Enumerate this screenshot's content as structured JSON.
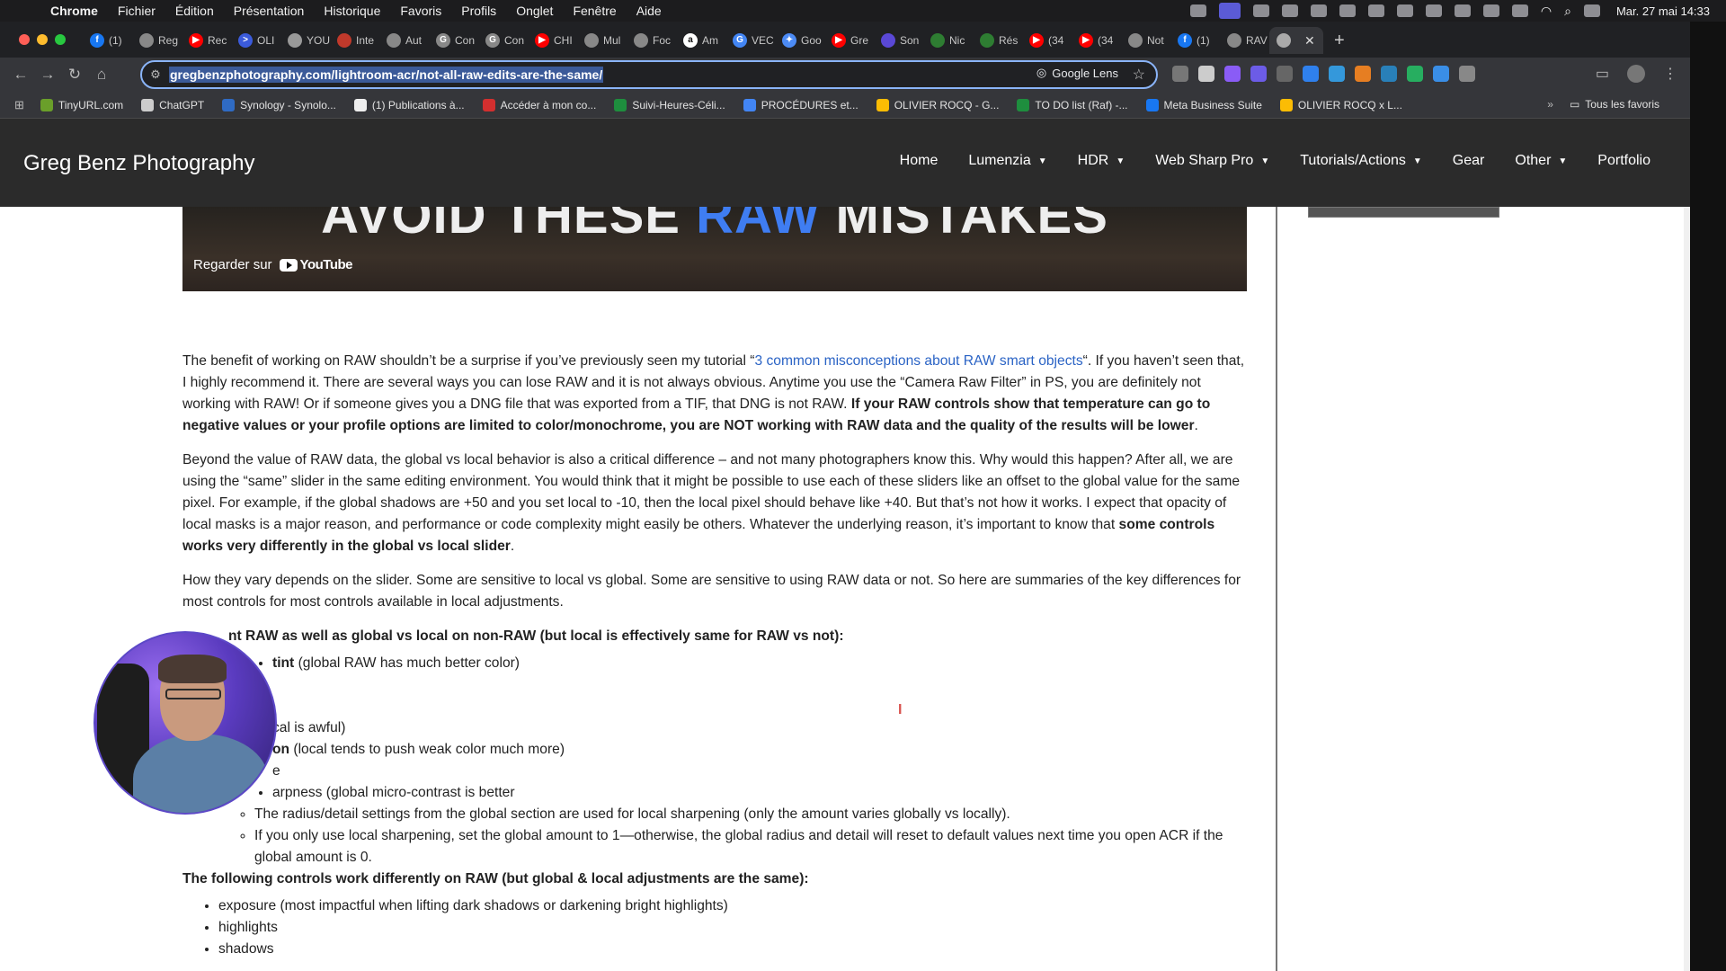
{
  "menubar": {
    "items": [
      "Chrome",
      "Fichier",
      "Édition",
      "Présentation",
      "Historique",
      "Favoris",
      "Profils",
      "Onglet",
      "Fenêtre",
      "Aide"
    ],
    "clock": "Mar. 27 mai  14:33"
  },
  "tabs": [
    {
      "label": "(1)",
      "color": "#1877f2",
      "glyph": "f"
    },
    {
      "label": "Reg",
      "color": "#888888",
      "glyph": ""
    },
    {
      "label": "Rec",
      "color": "#ff0000",
      "glyph": "▶"
    },
    {
      "label": "OLI",
      "color": "#3b5bdb",
      "glyph": ">"
    },
    {
      "label": "YOU",
      "color": "#999999",
      "glyph": ""
    },
    {
      "label": "Inte",
      "color": "#c0392b",
      "glyph": ""
    },
    {
      "label": "Aut",
      "color": "#888888",
      "glyph": ""
    },
    {
      "label": "Con",
      "color": "#888888",
      "glyph": "G"
    },
    {
      "label": "Con",
      "color": "#888888",
      "glyph": "G"
    },
    {
      "label": "CHI",
      "color": "#ff0000",
      "glyph": "▶"
    },
    {
      "label": "Mul",
      "color": "#888888",
      "glyph": ""
    },
    {
      "label": "Foc",
      "color": "#888888",
      "glyph": ""
    },
    {
      "label": "Am",
      "color": "#ffffff",
      "glyph": "a"
    },
    {
      "label": "VEC",
      "color": "#4285f4",
      "glyph": "G"
    },
    {
      "label": "Goo",
      "color": "#4c8bf5",
      "glyph": "✦"
    },
    {
      "label": "Gre",
      "color": "#ff0000",
      "glyph": "▶"
    },
    {
      "label": "Son",
      "color": "#5a48d6",
      "glyph": ""
    },
    {
      "label": "Nic",
      "color": "#2e7d32",
      "glyph": ""
    },
    {
      "label": "Rés",
      "color": "#2e7d32",
      "glyph": ""
    },
    {
      "label": "(34",
      "color": "#ff0000",
      "glyph": "▶"
    },
    {
      "label": "(34",
      "color": "#ff0000",
      "glyph": "▶"
    },
    {
      "label": "Not",
      "color": "#888888",
      "glyph": ""
    },
    {
      "label": "(1)",
      "color": "#1877f2",
      "glyph": "f"
    },
    {
      "label": "RAV",
      "color": "#888888",
      "glyph": ""
    },
    {
      "label": "",
      "color": "#aaaaaa",
      "glyph": ""
    }
  ],
  "omnibox": {
    "url": "gregbenzphotography.com/lightroom-acr/not-all-raw-edits-are-the-same/",
    "lens_label": "Google Lens"
  },
  "bookmarks": [
    {
      "label": "TinyURL.com",
      "color": "#6a9f2a"
    },
    {
      "label": "ChatGPT",
      "color": "#cccccc"
    },
    {
      "label": "Synology - Synolo...",
      "color": "#2f6bc4"
    },
    {
      "label": "(1) Publications à...",
      "color": "#eeeeee"
    },
    {
      "label": "Accéder à mon co...",
      "color": "#d32f2f"
    },
    {
      "label": "Suivi-Heures-Céli...",
      "color": "#1e8e3e"
    },
    {
      "label": "PROCÉDURES et...",
      "color": "#4285f4"
    },
    {
      "label": "OLIVIER ROCQ - G...",
      "color": "#fbbc04"
    },
    {
      "label": "TO DO list (Raf) -...",
      "color": "#1e8e3e"
    },
    {
      "label": "Meta Business Suite",
      "color": "#1877f2"
    },
    {
      "label": "OLIVIER ROCQ x L...",
      "color": "#fbbc04"
    }
  ],
  "bookmarks_right": "Tous les favoris",
  "site": {
    "brand": "Greg Benz Photography",
    "nav": [
      {
        "label": "Home",
        "dropdown": false
      },
      {
        "label": "Lumenzia",
        "dropdown": true
      },
      {
        "label": "HDR",
        "dropdown": true
      },
      {
        "label": "Web Sharp Pro",
        "dropdown": true
      },
      {
        "label": "Tutorials/Actions",
        "dropdown": true
      },
      {
        "label": "Gear",
        "dropdown": false
      },
      {
        "label": "Other",
        "dropdown": true
      },
      {
        "label": "Portfolio",
        "dropdown": false
      }
    ]
  },
  "video": {
    "title_a": "AVOID THESE ",
    "title_hl": "RAW",
    "title_b": " MISTAKES",
    "watch_label": "Regarder sur",
    "youtube_label": "YouTube"
  },
  "article": {
    "p1_a": "The benefit of working on RAW shouldn’t be a surprise if you’ve previously seen my tutorial “",
    "p1_link": "3 common misconceptions about RAW smart objects",
    "p1_b": "“. If you haven’t  seen that, I highly recommend it. There are several ways you can lose RAW and it is not always obvious. Anytime you use the “Camera Raw Filter” in PS, you are definitely not working with RAW! Or if someone gives you a DNG file that was exported from a TIF, that DNG is not RAW. ",
    "p1_bold": "If your RAW controls show that temperature can go to negative values or your profile options are limited to color/monochrome, you are NOT working with RAW data and the quality of the results will be lower",
    "p1_end": ".",
    "p2_a": "Beyond the value of RAW data, the global vs local behavior is also a critical difference – and not many photographers know this. Why would this happen? After all, we are using the “same” slider in the same editing environment. You would think that it might be possible to use each of these sliders like an offset to the global value for the same pixel. For example, if the global shadows are +50 and you set local to -10, then the local pixel should behave like +40. But that’s not how it works. I expect that opacity of local masks is a major reason, and performance or code complexity might easily be others. Whatever the underlying reason, it’s important to know that ",
    "p2_bold": "some controls works very differently in the global vs local slider",
    "p2_end": ".",
    "p3": "How they vary depends on the slider. Some are sensitive to local vs global. Some are sensitive to using RAW data or not. So here are summaries of the key differences for most controls for most controls available in local adjustments.",
    "h1": "nt RAW as well as global vs local on non-RAW (but local is effectively same for RAW vs not):",
    "list1": [
      {
        "bold": "tint",
        "text": " (global RAW has much better color)"
      },
      {
        "bold": "",
        "text": ""
      },
      {
        "bold": "",
        "text": ""
      },
      {
        "bold": "",
        "text": "cal is awful)"
      },
      {
        "bold": "on",
        "text": " (local tends to push weak color much more)"
      },
      {
        "bold": "",
        "text": "e"
      },
      {
        "bold": "",
        "text": "arpness (global micro-contrast is better"
      }
    ],
    "sub1": [
      "The radius/detail settings from the global section are used for local sharpening (only the amount varies globally vs locally).",
      "If you only use local sharpening, set the global amount to 1—otherwise, the global radius and detail will reset to default values next time you open ACR if the global amount is 0."
    ],
    "h2": "The following controls work differently on RAW (but global & local adjustments are the same):",
    "list2": [
      "exposure (most impactful when lifting dark shadows or darkening bright highlights)",
      "highlights",
      "shadows"
    ]
  }
}
